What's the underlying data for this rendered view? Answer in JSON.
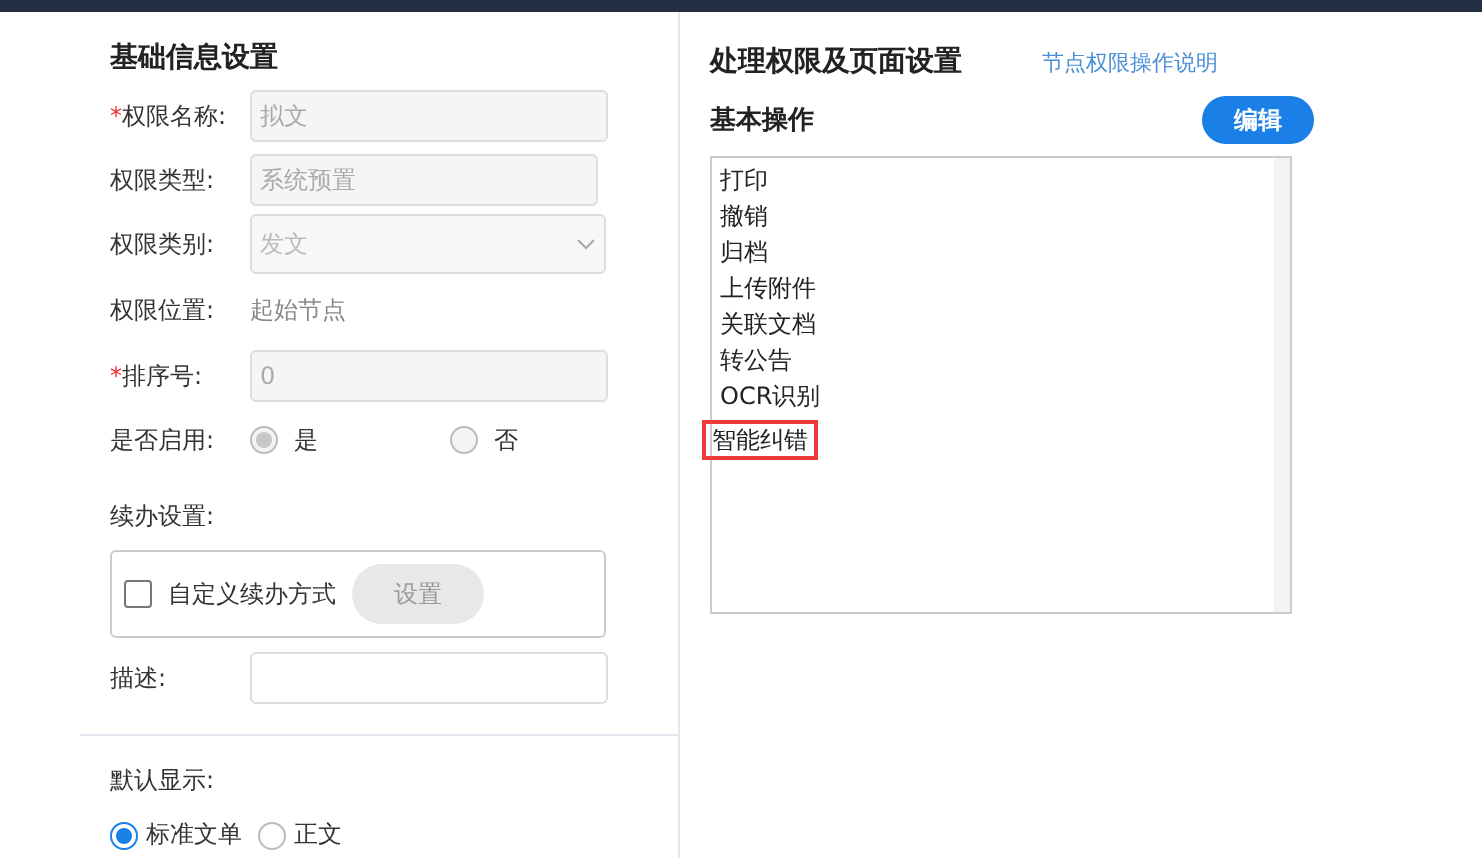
{
  "basic_info": {
    "title": "基础信息设置",
    "fields": [
      {
        "kind": "input",
        "required_mark": "*",
        "label": "权限名称:",
        "value": "拟文"
      },
      {
        "kind": "input",
        "label": "权限类型:",
        "value": "系统预置"
      },
      {
        "kind": "select",
        "label": "权限类别:",
        "value": "发文"
      },
      {
        "kind": "text",
        "label": "权限位置:",
        "value": "起始节点"
      },
      {
        "kind": "input",
        "required_mark": "*",
        "label": "排序号:",
        "value": "0"
      },
      {
        "kind": "radio",
        "label": "是否启用:",
        "options": [
          {
            "label": "是",
            "selected": true,
            "disabled": true
          },
          {
            "label": "否",
            "selected": false,
            "disabled": true
          }
        ]
      }
    ],
    "continue_label": "续办设置:",
    "custom_checkbox": {
      "label": "自定义续办方式",
      "checked": false
    },
    "setup_button": {
      "label": "设置",
      "disabled": true
    },
    "description": {
      "label": "描述:"
    }
  },
  "default_display": {
    "label": "默认显示:",
    "options": [
      {
        "label": "标准文单",
        "selected": true
      },
      {
        "label": "正文",
        "selected": false
      }
    ]
  },
  "permissions": {
    "title": "处理权限及页面设置",
    "help_link": "节点权限操作说明",
    "section": "基本操作",
    "edit_button": "编辑",
    "operations": [
      {
        "label": "打印",
        "highlighted": false
      },
      {
        "label": "撤销",
        "highlighted": false
      },
      {
        "label": "归档",
        "highlighted": false
      },
      {
        "label": "上传附件",
        "highlighted": false
      },
      {
        "label": "关联文档",
        "highlighted": false
      },
      {
        "label": "转公告",
        "highlighted": false
      },
      {
        "label": "OCR识别",
        "highlighted": false
      },
      {
        "label": "智能纠错",
        "highlighted": true
      }
    ]
  }
}
